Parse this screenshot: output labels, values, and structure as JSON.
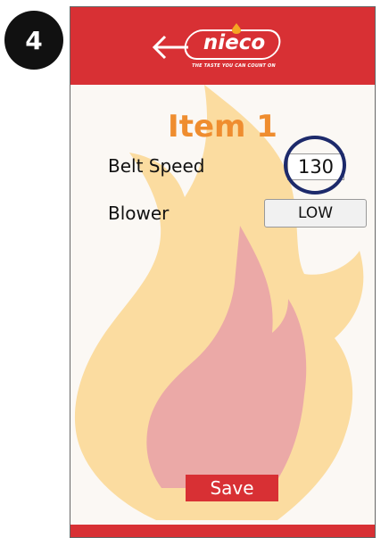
{
  "step": {
    "number": "4"
  },
  "header": {
    "brand": "nieco",
    "tagline": "THE TASTE YOU CAN COUNT ON",
    "icons": {
      "back": "left-arrow-icon",
      "logo_drop": "flame-drop-icon"
    }
  },
  "main": {
    "title": "Item 1",
    "belt_speed": {
      "label": "Belt Speed",
      "value": "130"
    },
    "blower": {
      "label": "Blower",
      "value": "LOW"
    },
    "save_label": "Save"
  },
  "colors": {
    "brand_red": "#d83034",
    "title_orange": "#ef8d2f",
    "highlight_navy": "#1d2a6b",
    "flame_outer": "#fbdca0",
    "flame_inner": "#eba9a7"
  }
}
